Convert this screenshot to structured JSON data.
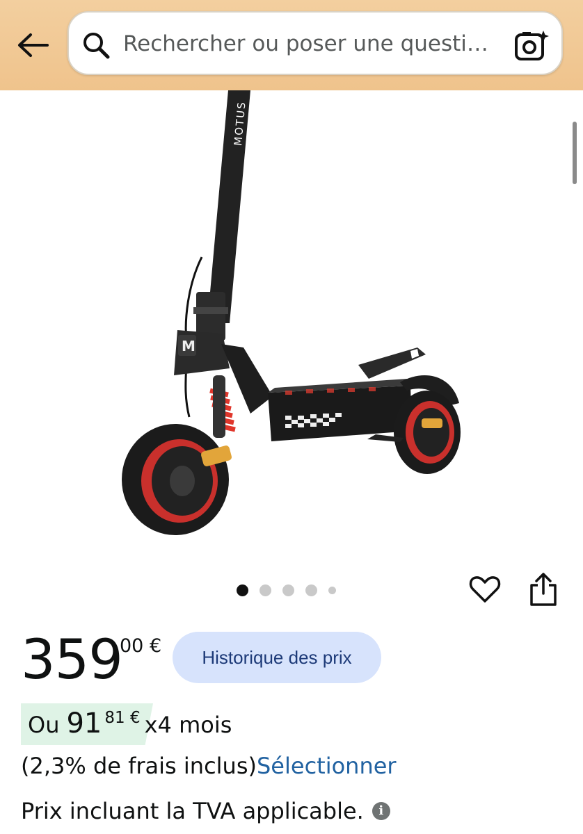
{
  "header": {
    "search_placeholder": "Rechercher ou poser une questi…"
  },
  "icons": {
    "back": "arrow-left-icon",
    "search": "search-icon",
    "camera": "camera-lens-icon",
    "favorite": "heart-icon",
    "share": "share-icon",
    "info": "info-icon"
  },
  "gallery": {
    "brand_text": "MOTUS",
    "logo_letter": "M",
    "dots_count": 5,
    "active_dot": 1
  },
  "price": {
    "whole": "359",
    "fraction_currency": "00 €",
    "history_button": "Historique des prix"
  },
  "installment": {
    "prefix": "Ou",
    "amount_whole": "91",
    "amount_fraction": "81 €",
    "suffix": "x4 mois"
  },
  "fees": {
    "text": "(2,3% de frais inclus)",
    "link": "Sélectionner"
  },
  "tva": {
    "text": "Prix incluant la TVA applicable."
  },
  "colors": {
    "header_bg": "#efc38c",
    "history_bg": "#d7e3fc",
    "link": "#2162a1",
    "installment_bg": "#dff3e6"
  }
}
